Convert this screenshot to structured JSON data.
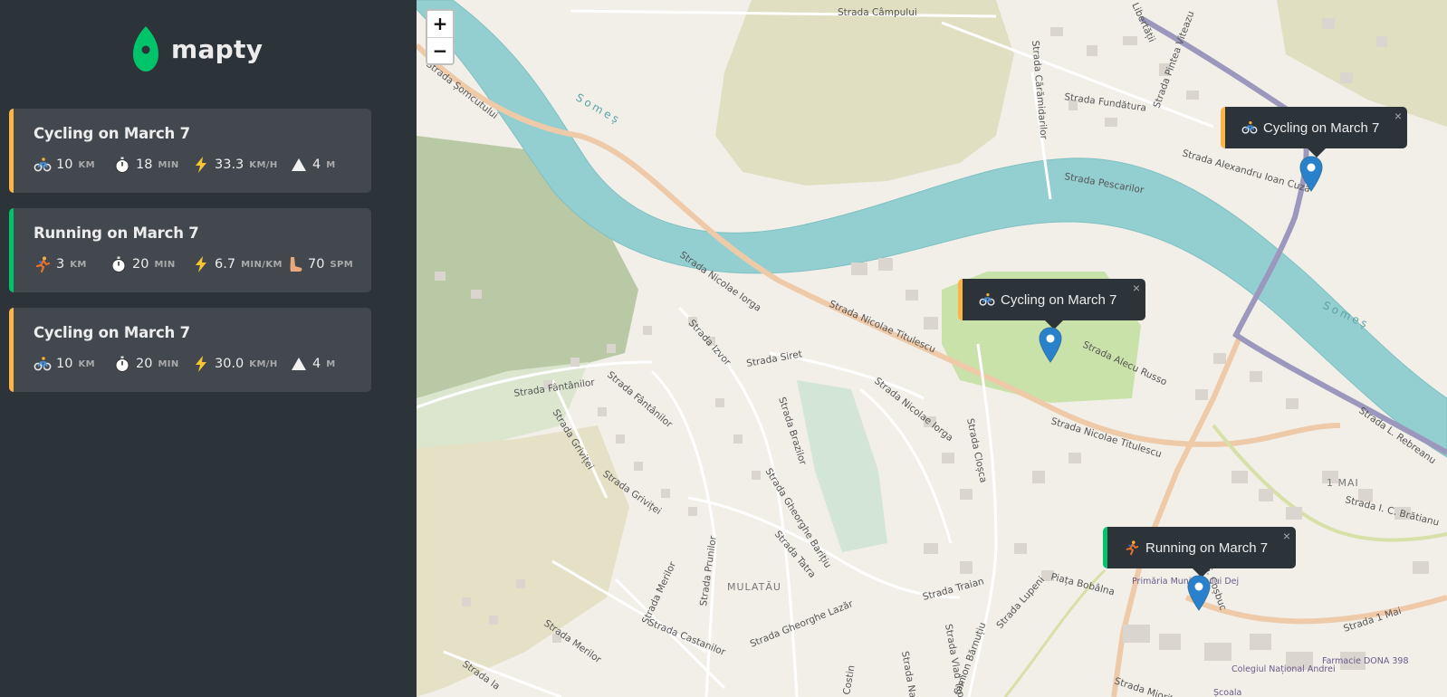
{
  "app": {
    "name": "mapty",
    "brand_green": "#00c46a",
    "brand_yellow": "#ffb545",
    "bg_dark": "#2d3439"
  },
  "workouts": [
    {
      "type": "cycling",
      "title": "Cycling on March 7",
      "distance": "10",
      "distance_unit": "KM",
      "duration": "18",
      "duration_unit": "MIN",
      "speed": "33.3",
      "speed_unit": "KM/H",
      "elevation": "4",
      "elevation_unit": "M"
    },
    {
      "type": "running",
      "title": "Running on March 7",
      "distance": "3",
      "distance_unit": "KM",
      "duration": "20",
      "duration_unit": "MIN",
      "pace": "6.7",
      "pace_unit": "MIN/KM",
      "cadence": "70",
      "cadence_unit": "SPM"
    },
    {
      "type": "cycling",
      "title": "Cycling on March 7",
      "distance": "10",
      "distance_unit": "KM",
      "duration": "20",
      "duration_unit": "MIN",
      "speed": "30.0",
      "speed_unit": "KM/H",
      "elevation": "4",
      "elevation_unit": "M"
    }
  ],
  "map": {
    "zoom_in": "+",
    "zoom_out": "−",
    "popups": [
      {
        "type": "cycling",
        "text": "Cycling on March 7",
        "close": "×"
      },
      {
        "type": "cycling",
        "text": "Cycling on March 7",
        "close": "×"
      },
      {
        "type": "running",
        "text": "Running on March 7",
        "close": "×"
      }
    ],
    "labels": {
      "strada_campului": "Strada Câmpului",
      "somes_1": "Someș",
      "somes_2": "Someș",
      "strada_somcutului": "Strada Șomcutului",
      "strada_caramidarilor": "Strada Cărămidarilor",
      "strada_fundatura": "Strada Fundătura",
      "strada_pintea": "Strada Pintea Viteazu",
      "strada_libertatii": "Libertății",
      "strada_pescarilor": "Strada Pescarilor",
      "strada_cuza": "Strada Alexandru Ioan Cuza",
      "strada_iorga_1": "Strada Nicolae Iorga",
      "strada_iorga_2": "Strada Nicolae Iorga",
      "strada_titulescu_1": "Strada Nicolae Titulescu",
      "strada_titulescu_2": "Strada Nicolae Titulescu",
      "strada_russo": "Strada Alecu Russo",
      "strada_izvor": "Strada Izvor",
      "strada_siret": "Strada Siret",
      "strada_fantanilor_1": "Strada Fântânilor",
      "strada_fantanilor_2": "Strada Fântânilor",
      "strada_grivitei_1": "Strada Griviței",
      "strada_grivitei_2": "Strada Griviței",
      "strada_brazilor": "Strada Brazilor",
      "strada_baritiu": "Strada Gheorghe Barițiu",
      "strada_closca": "Strada Cloșca",
      "strada_tatra": "Strada Tatra",
      "strada_prunilor": "Strada Prunilor",
      "strada_merilor_1": "Strada Merilor",
      "strada_merilor_2": "Strada Merilor",
      "strada_castanilor": "Strada Castanilor",
      "strada_lazar": "Strada Gheorghe Lazăr",
      "strada_traian": "Strada Traian",
      "strada_lupeni": "Strada Lupeni",
      "strada_barnutiu": "Simion Bărnuțiu",
      "strada_vlad": "Strada Vlad Tepeș",
      "piata_bobalna": "Piața Bobâlna",
      "mulatau": "MULATĂU",
      "unu_mai": "1 MAI",
      "strada_1_mai": "Strada 1 Mai",
      "strada_bratianu": "Strada I. C. Brătianu",
      "strada_rebreanu": "Strada L. Rebreanu",
      "strada_cosbuc": "G. Coșbuc",
      "primaria": "Primăria Municipiului Dej",
      "farmacie": "Farmacie DONA 398",
      "colegiu": "Colegiul Național Andrei",
      "scoala": "Școala",
      "strada_mioritei": "Strada Mioriței",
      "strada_costin": "Costin",
      "strada_na": "Strada Na",
      "strada_ia": "Strada Ia"
    }
  }
}
